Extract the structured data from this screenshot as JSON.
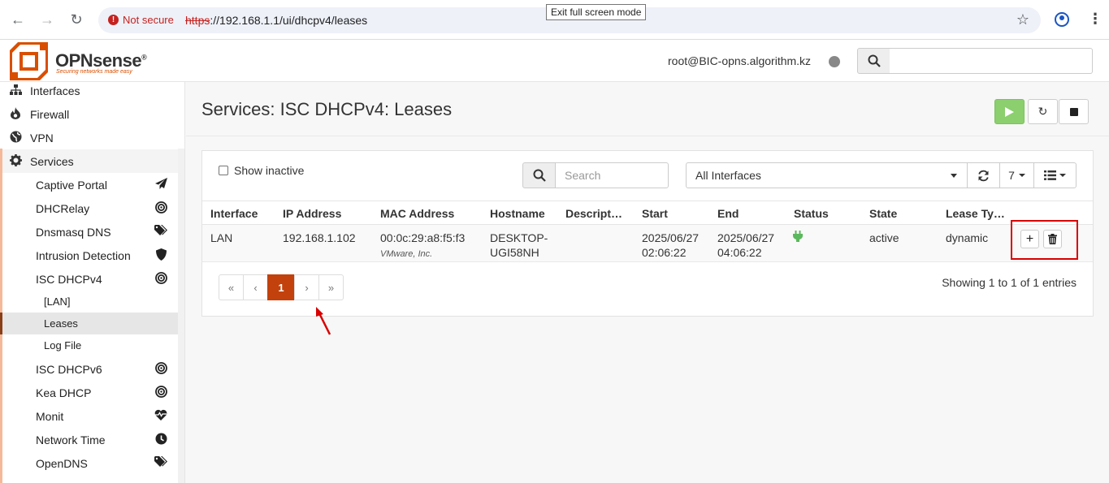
{
  "browser": {
    "not_secure_label": "Not secure",
    "url_scheme": "https",
    "url_rest": "://192.168.1.1/ui/dhcpv4/leases",
    "fullscreen_tip": "Exit full screen mode"
  },
  "header": {
    "logo_text": "OPNsense",
    "logo_reg": "®",
    "tagline": "Securing networks made easy",
    "user": "root@BIC-opns.algorithm.kz",
    "search_placeholder": ""
  },
  "sidebar": {
    "top": [
      {
        "label": "Interfaces",
        "icon": "sitemap-icon"
      },
      {
        "label": "Firewall",
        "icon": "fire-icon"
      },
      {
        "label": "VPN",
        "icon": "globe-icon"
      },
      {
        "label": "Services",
        "icon": "gear-icon"
      }
    ],
    "services": [
      {
        "label": "Captive Portal",
        "icon": "paper-plane-icon"
      },
      {
        "label": "DHCRelay",
        "icon": "bullseye-icon"
      },
      {
        "label": "Dnsmasq DNS",
        "icon": "tags-icon"
      },
      {
        "label": "Intrusion Detection",
        "icon": "shield-icon"
      },
      {
        "label": "ISC DHCPv4",
        "icon": "bullseye-icon"
      }
    ],
    "dhcpv4_children": [
      {
        "label": "[LAN]"
      },
      {
        "label": "Leases"
      },
      {
        "label": "Log File"
      }
    ],
    "services_more": [
      {
        "label": "ISC DHCPv6",
        "icon": "bullseye-icon"
      },
      {
        "label": "Kea DHCP",
        "icon": "bullseye-icon"
      },
      {
        "label": "Monit",
        "icon": "heartbeat-icon"
      },
      {
        "label": "Network Time",
        "icon": "clock-icon"
      },
      {
        "label": "OpenDNS",
        "icon": "tags-icon"
      }
    ]
  },
  "page": {
    "title": "Services: ISC DHCPv4: Leases"
  },
  "grid": {
    "show_inactive_label": "Show inactive",
    "search_placeholder": "Search",
    "interface_filter": "All Interfaces",
    "page_size": "7",
    "columns": [
      "Interface",
      "IP Address",
      "MAC Address",
      "Hostname",
      "Descript…",
      "Start",
      "End",
      "Status",
      "State",
      "Lease Ty…"
    ],
    "rows": [
      {
        "interface": "LAN",
        "ip": "192.168.1.102",
        "mac": "00:0c:29:a8:f5:f3",
        "vendor": "VMware, Inc.",
        "hostname_1": "DESKTOP-",
        "hostname_2": "UGI58NH",
        "description": "",
        "start_date": "2025/06/27",
        "start_time": "02:06:22",
        "end_date": "2025/06/27",
        "end_time": "04:06:22",
        "status_icon": "plug-icon",
        "state": "active",
        "lease_type": "dynamic"
      }
    ],
    "pager": {
      "first": "«",
      "prev": "‹",
      "current": "1",
      "next": "›",
      "last": "»"
    },
    "info": "Showing 1 to 1 of 1 entries"
  },
  "colors": {
    "accent": "#d94f00",
    "active_page": "#c2410c",
    "play_button": "#8bcf6e",
    "annotation": "#d80000"
  }
}
